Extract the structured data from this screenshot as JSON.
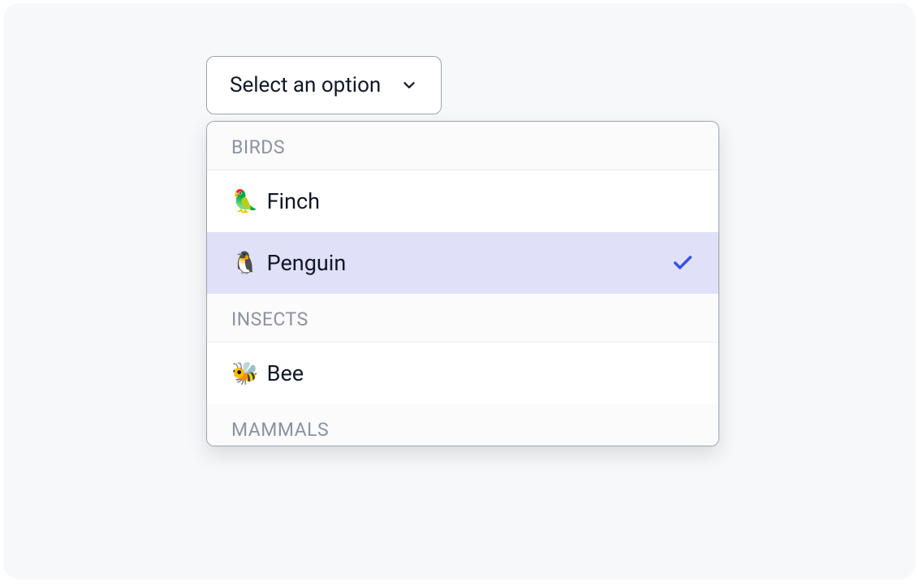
{
  "select": {
    "placeholder": "Select an option",
    "groups": [
      {
        "label": "BIRDS",
        "options": [
          {
            "emoji": "🦜",
            "label": "Finch",
            "selected": false
          },
          {
            "emoji": "🐧",
            "label": "Penguin",
            "selected": true
          }
        ]
      },
      {
        "label": "INSECTS",
        "options": [
          {
            "emoji": "🐝",
            "label": "Bee",
            "selected": false
          }
        ]
      },
      {
        "label": "MAMMALS",
        "options": []
      }
    ]
  },
  "colors": {
    "selected_bg": "#e0e0f8",
    "check": "#3C50E0",
    "border": "#9ca3af",
    "group_text": "#8b92a0"
  }
}
